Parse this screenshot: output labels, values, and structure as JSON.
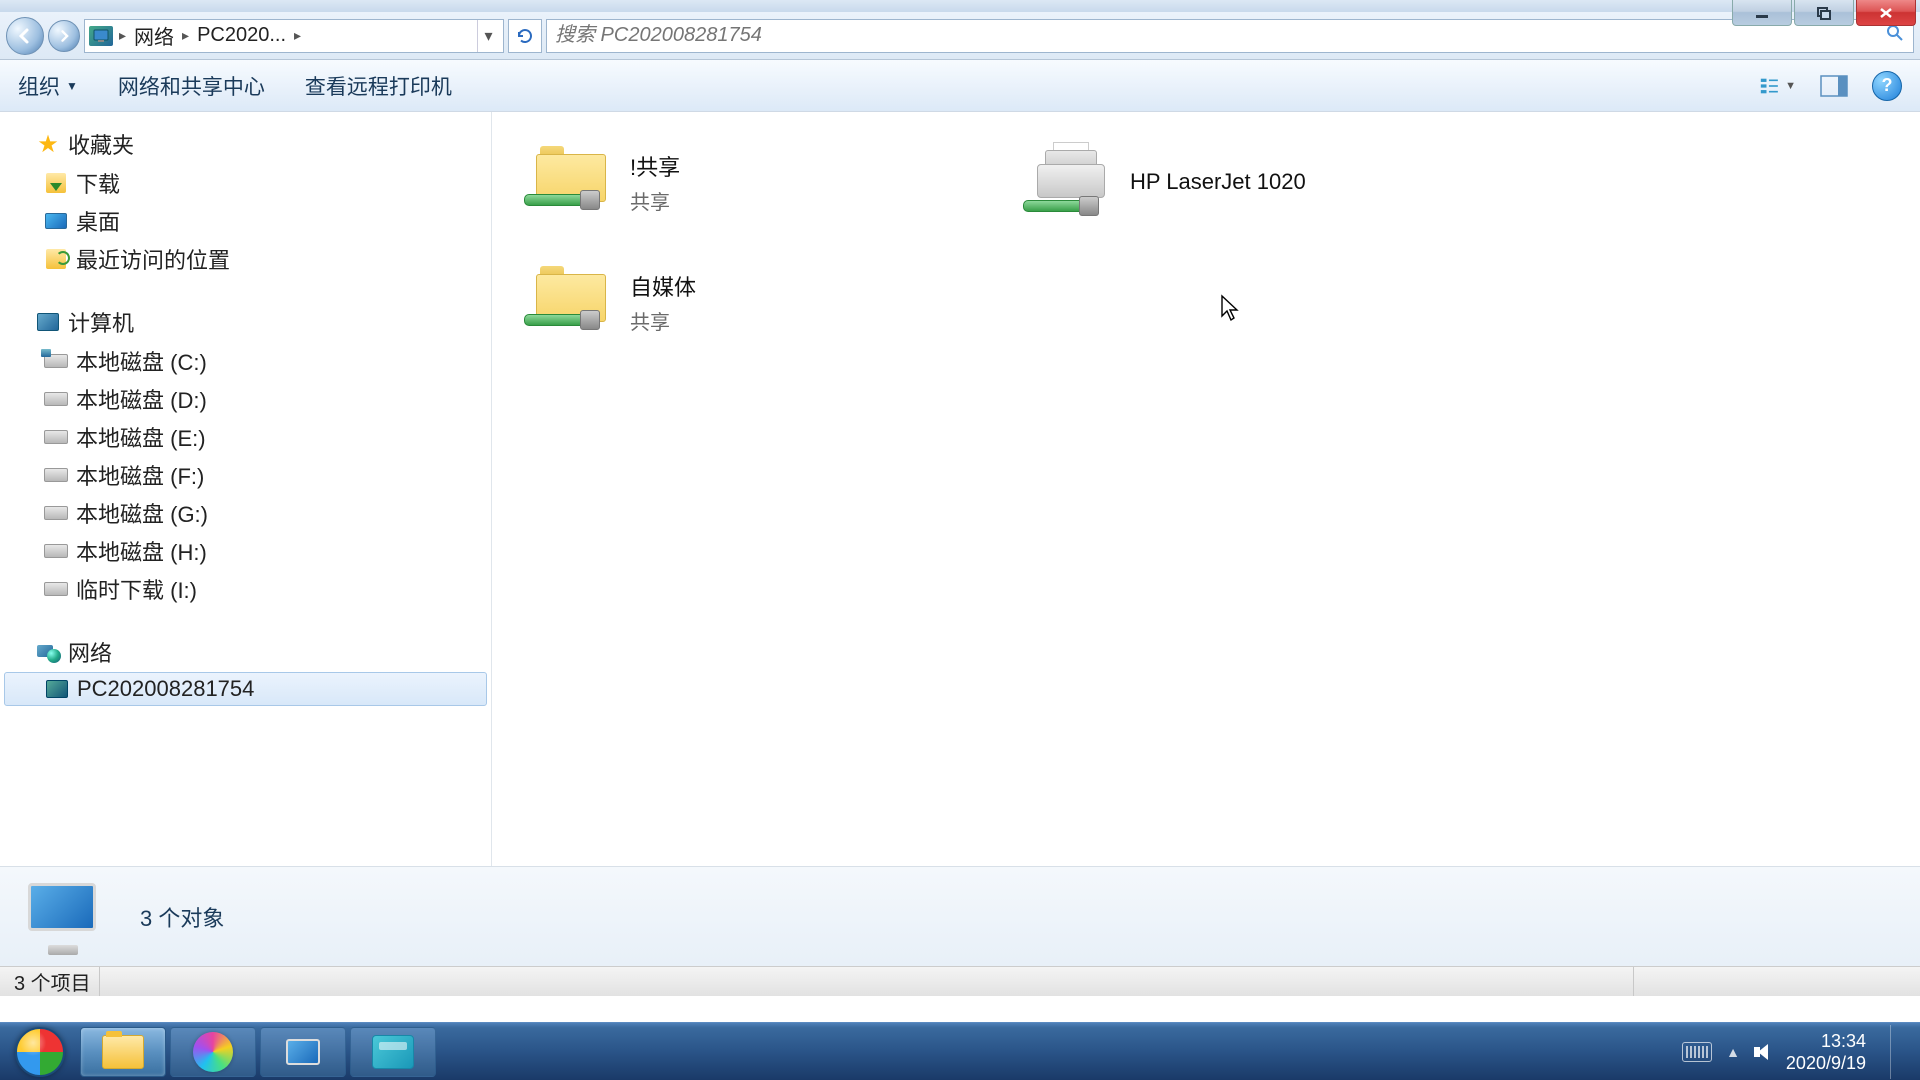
{
  "window": {
    "breadcrumb": {
      "root": "网络",
      "pc": "PC2020...",
      "sep": "▸"
    },
    "search_placeholder": "搜索 PC202008281754"
  },
  "toolbar": {
    "organize": "组织",
    "network_center": "网络和共享中心",
    "view_printers": "查看远程打印机"
  },
  "nav": {
    "favorites": "收藏夹",
    "downloads": "下载",
    "desktop": "桌面",
    "recent": "最近访问的位置",
    "computer": "计算机",
    "drives": [
      "本地磁盘 (C:)",
      "本地磁盘 (D:)",
      "本地磁盘 (E:)",
      "本地磁盘 (F:)",
      "本地磁盘 (G:)",
      "本地磁盘 (H:)",
      "临时下载 (I:)"
    ],
    "network": "网络",
    "network_pc": "PC202008281754"
  },
  "items": {
    "share1_name": "!共享",
    "share1_sub": "共享",
    "share2_name": "自媒体",
    "share2_sub": "共享",
    "printer_name": "HP LaserJet 1020"
  },
  "details": {
    "count_text": "3 个对象"
  },
  "status": {
    "items_text": "3 个项目"
  },
  "tray": {
    "time": "13:34",
    "date": "2020/9/19"
  }
}
